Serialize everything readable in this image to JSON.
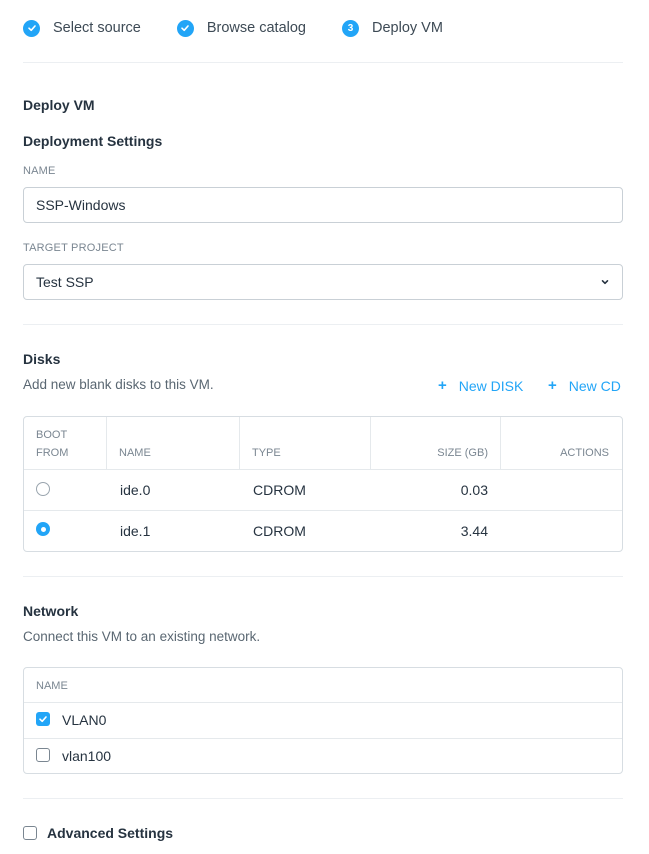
{
  "wizard": {
    "steps": [
      {
        "label": "Select source",
        "state": "done"
      },
      {
        "label": "Browse catalog",
        "state": "done"
      },
      {
        "label": "Deploy VM",
        "state": "current",
        "number": "3"
      }
    ],
    "accent_color": "#22a5f7"
  },
  "page": {
    "title": "Deploy VM",
    "section_title": "Deployment Settings"
  },
  "settings": {
    "name_label": "NAME",
    "name_value": "SSP-Windows",
    "project_label": "TARGET PROJECT",
    "project_value": "Test SSP"
  },
  "disks": {
    "title": "Disks",
    "description": "Add new blank disks to this VM.",
    "new_disk_label": "New DISK",
    "new_cd_label": "New CD",
    "columns": {
      "boot_line1": "BOOT",
      "boot_line2": "FROM",
      "name": "NAME",
      "type": "TYPE",
      "size": "SIZE (GB)",
      "actions": "ACTIONS"
    },
    "rows": [
      {
        "name": "ide.0",
        "type": "CDROM",
        "size": "0.03",
        "boot": false
      },
      {
        "name": "ide.1",
        "type": "CDROM",
        "size": "3.44",
        "boot": true
      }
    ]
  },
  "network": {
    "title": "Network",
    "description": "Connect this VM to an existing network.",
    "column_name": "NAME",
    "rows": [
      {
        "name": "VLAN0",
        "checked": true
      },
      {
        "name": "vlan100",
        "checked": false
      }
    ]
  },
  "advanced": {
    "label": "Advanced Settings",
    "checked": false
  }
}
